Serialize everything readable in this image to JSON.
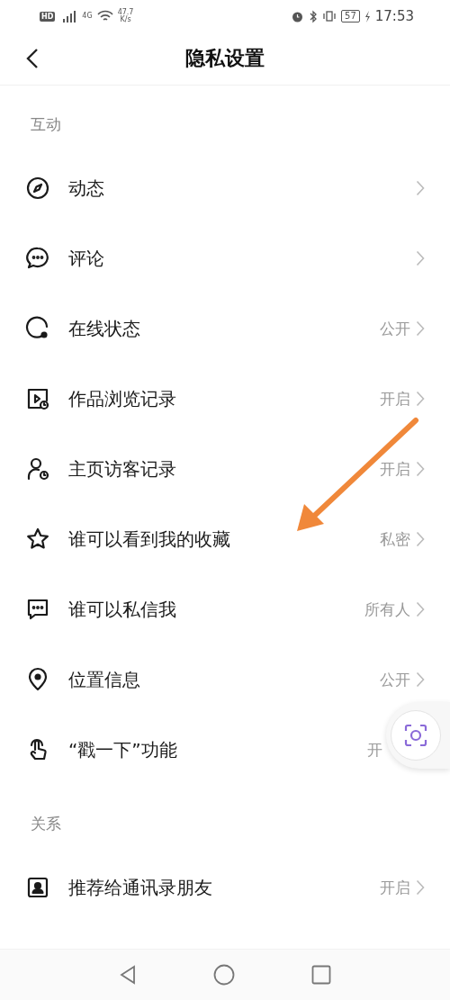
{
  "status_bar": {
    "hd": "HD",
    "network": "4G",
    "speed": "47.7",
    "speed_unit": "K/s",
    "battery": "57",
    "time": "17:53"
  },
  "header": {
    "title": "隐私设置"
  },
  "sections": [
    {
      "title": "互动",
      "items": [
        {
          "label": "动态",
          "chevron": true
        },
        {
          "label": "评论",
          "chevron": true
        },
        {
          "label": "在线状态",
          "value": "公开",
          "chevron": true
        },
        {
          "label": "作品浏览记录",
          "value": "开启",
          "chevron": true
        },
        {
          "label": "主页访客记录",
          "value": "开启",
          "chevron": true
        },
        {
          "label": "谁可以看到我的收藏",
          "value": "私密",
          "chevron": true
        },
        {
          "label": "谁可以私信我",
          "value": "所有人",
          "chevron": true
        },
        {
          "label": "位置信息",
          "value": "公开",
          "chevron": true
        },
        {
          "label": "“戳一下”功能",
          "value": "开",
          "chevron": false
        }
      ]
    },
    {
      "title": "关系",
      "items": [
        {
          "label": "推荐给通讯录朋友",
          "value": "开启",
          "chevron": true
        }
      ]
    }
  ]
}
